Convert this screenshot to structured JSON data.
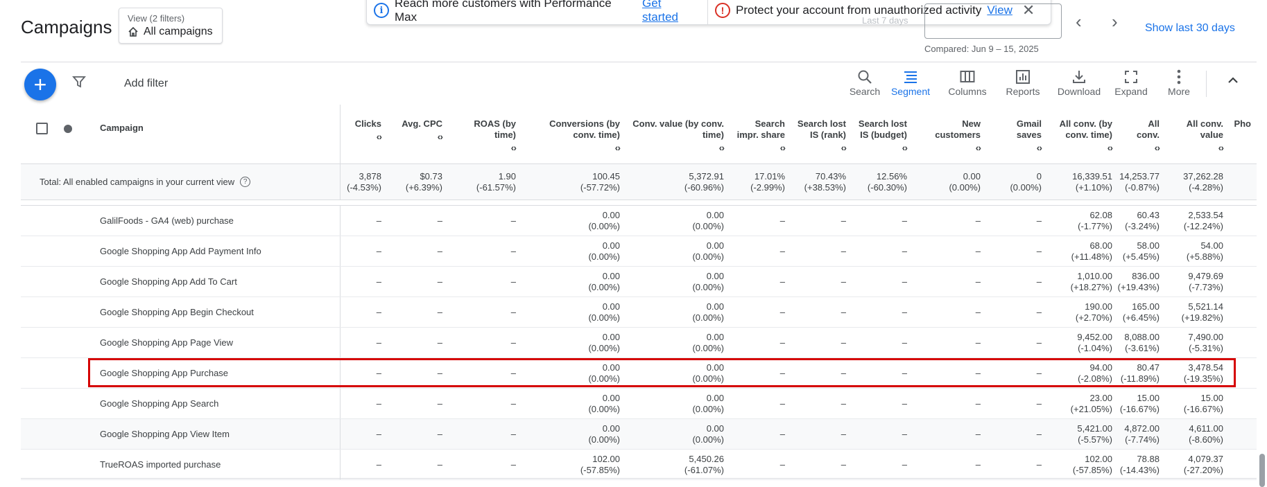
{
  "header": {
    "title": "Campaigns",
    "view_sub": "View (2 filters)",
    "view_main": "All campaigns",
    "notice1_text": "Reach more customers with Performance Max",
    "notice1_link": "Get started",
    "notice2_text": "Protect your account from unauthorized activity",
    "notice2_link": "View",
    "date_label_faint": "Last 7 days",
    "compared": "Compared: Jun 9 – 15, 2025",
    "show_last": "Show last 30 days"
  },
  "toolbar": {
    "add_filter": "Add filter",
    "tools": [
      {
        "label": "Search",
        "icon": "search-icon"
      },
      {
        "label": "Segment",
        "icon": "segment-icon"
      },
      {
        "label": "Columns",
        "icon": "columns-icon"
      },
      {
        "label": "Reports",
        "icon": "reports-icon"
      },
      {
        "label": "Download",
        "icon": "download-icon"
      },
      {
        "label": "Expand",
        "icon": "expand-icon"
      },
      {
        "label": "More",
        "icon": "more-vert-icon"
      }
    ]
  },
  "table": {
    "columns": [
      "Campaign",
      "Clicks",
      "Avg. CPC",
      "ROAS (by time)",
      "Conversions (by conv. time)",
      "Conv. value (by conv. time)",
      "Search impr. share",
      "Search lost IS (rank)",
      "Search lost IS (budget)",
      "New customers",
      "Gmail saves",
      "All conv. (by conv. time)",
      "All conv.",
      "All conv. value",
      "Pho"
    ],
    "total": {
      "label": "Total: All enabled campaigns in your current view",
      "values": [
        [
          "3,878",
          "(-4.53%)"
        ],
        [
          "$0.73",
          "(+6.39%)"
        ],
        [
          "1.90",
          "(-61.57%)"
        ],
        [
          "100.45",
          "(-57.72%)"
        ],
        [
          "5,372.91",
          "(-60.96%)"
        ],
        [
          "17.01%",
          "(-2.99%)"
        ],
        [
          "70.43%",
          "(+38.53%)"
        ],
        [
          "12.56%",
          "(-60.30%)"
        ],
        [
          "0.00",
          "(0.00%)"
        ],
        [
          "0",
          "(0.00%)"
        ],
        [
          "16,339.51",
          "(+1.10%)"
        ],
        [
          "14,253.77",
          "(-0.87%)"
        ],
        [
          "37,262.28",
          "(-4.28%)"
        ]
      ]
    },
    "rows": [
      {
        "name": "GalilFoods - GA4 (web) purchase",
        "conv": [
          "0.00",
          "(0.00%)"
        ],
        "value": [
          "0.00",
          "(0.00%)"
        ],
        "allconv_time": [
          "62.08",
          "(-1.77%)"
        ],
        "allconv": [
          "60.43",
          "(-3.24%)"
        ],
        "allvalue": [
          "2,533.54",
          "(-12.24%)"
        ]
      },
      {
        "name": "Google Shopping App Add Payment Info",
        "conv": [
          "0.00",
          "(0.00%)"
        ],
        "value": [
          "0.00",
          "(0.00%)"
        ],
        "allconv_time": [
          "68.00",
          "(+11.48%)"
        ],
        "allconv": [
          "58.00",
          "(+5.45%)"
        ],
        "allvalue": [
          "54.00",
          "(+5.88%)"
        ]
      },
      {
        "name": "Google Shopping App Add To Cart",
        "conv": [
          "0.00",
          "(0.00%)"
        ],
        "value": [
          "0.00",
          "(0.00%)"
        ],
        "allconv_time": [
          "1,010.00",
          "(+18.27%)"
        ],
        "allconv": [
          "836.00",
          "(+19.43%)"
        ],
        "allvalue": [
          "9,479.69",
          "(-7.73%)"
        ]
      },
      {
        "name": "Google Shopping App Begin Checkout",
        "conv": [
          "0.00",
          "(0.00%)"
        ],
        "value": [
          "0.00",
          "(0.00%)"
        ],
        "allconv_time": [
          "190.00",
          "(+2.70%)"
        ],
        "allconv": [
          "165.00",
          "(+6.45%)"
        ],
        "allvalue": [
          "5,521.14",
          "(+19.82%)"
        ]
      },
      {
        "name": "Google Shopping App Page View",
        "conv": [
          "0.00",
          "(0.00%)"
        ],
        "value": [
          "0.00",
          "(0.00%)"
        ],
        "allconv_time": [
          "9,452.00",
          "(-1.04%)"
        ],
        "allconv": [
          "8,088.00",
          "(-3.61%)"
        ],
        "allvalue": [
          "7,490.00",
          "(-5.31%)"
        ]
      },
      {
        "name": "Google Shopping App Purchase",
        "conv": [
          "0.00",
          "(0.00%)"
        ],
        "value": [
          "0.00",
          "(0.00%)"
        ],
        "allconv_time": [
          "94.00",
          "(-2.08%)"
        ],
        "allconv": [
          "80.47",
          "(-11.89%)"
        ],
        "allvalue": [
          "3,478.54",
          "(-19.35%)"
        ]
      },
      {
        "name": "Google Shopping App Search",
        "conv": [
          "0.00",
          "(0.00%)"
        ],
        "value": [
          "0.00",
          "(0.00%)"
        ],
        "allconv_time": [
          "23.00",
          "(+21.05%)"
        ],
        "allconv": [
          "15.00",
          "(-16.67%)"
        ],
        "allvalue": [
          "15.00",
          "(-16.67%)"
        ]
      },
      {
        "name": "Google Shopping App View Item",
        "conv": [
          "0.00",
          "(0.00%)"
        ],
        "value": [
          "0.00",
          "(0.00%)"
        ],
        "allconv_time": [
          "5,421.00",
          "(-5.57%)"
        ],
        "allconv": [
          "4,872.00",
          "(-7.74%)"
        ],
        "allvalue": [
          "4,611.00",
          "(-8.60%)"
        ]
      },
      {
        "name": "TrueROAS imported purchase",
        "conv": [
          "102.00",
          "(-57.85%)"
        ],
        "value": [
          "5,450.26",
          "(-61.07%)"
        ],
        "allconv_time": [
          "102.00",
          "(-57.85%)"
        ],
        "allconv": [
          "78.88",
          "(-14.43%)"
        ],
        "allvalue": [
          "4,079.37",
          "(-27.20%)"
        ]
      }
    ],
    "dash": "–"
  }
}
